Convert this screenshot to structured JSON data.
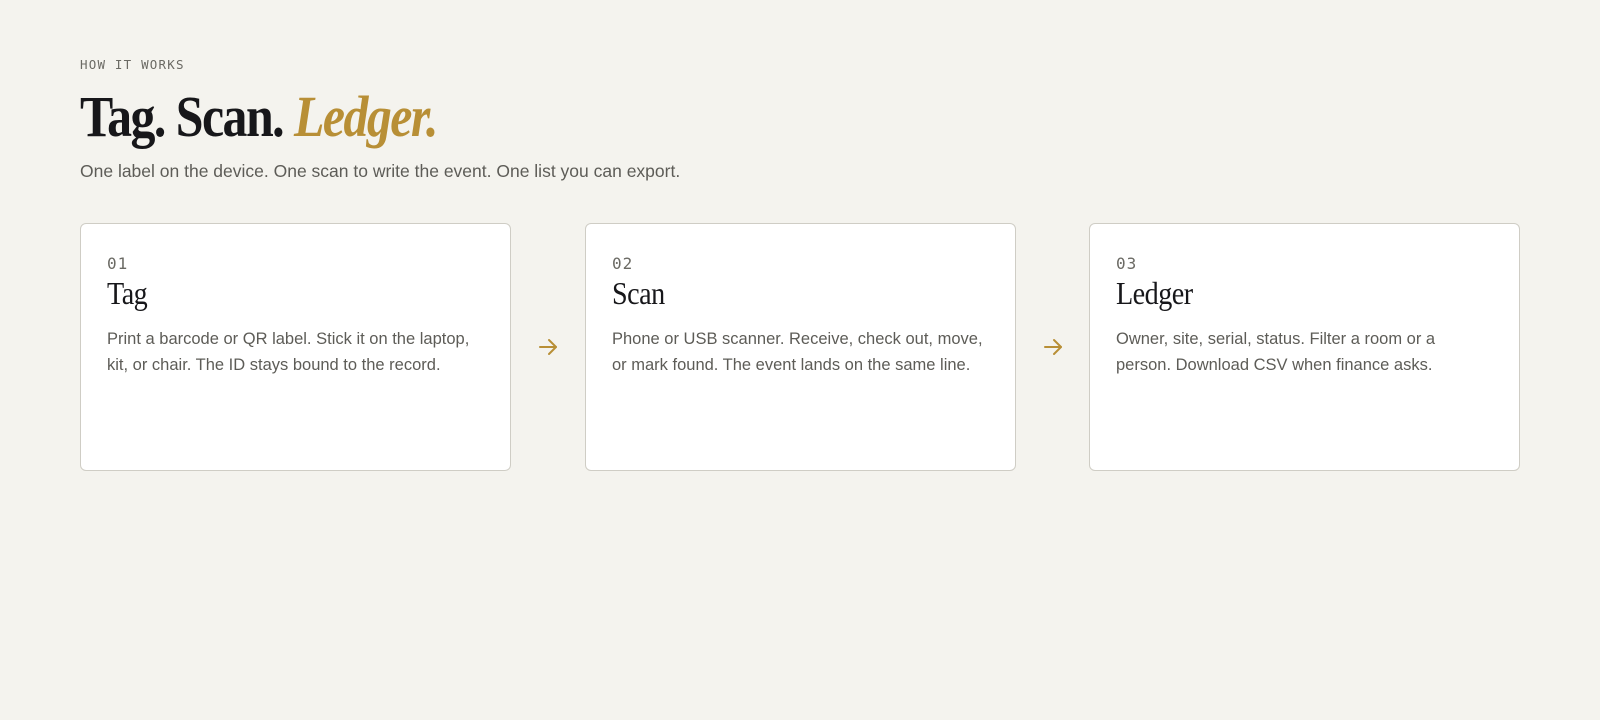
{
  "section": {
    "eyebrow": "HOW IT WORKS",
    "title_part1": "Tag. Scan.",
    "title_accent": "Ledger.",
    "subtitle": "One label on the device. One scan to write the event. One list you can export."
  },
  "steps": [
    {
      "number": "01",
      "title": "Tag",
      "body": "Print a barcode or QR label. Stick it on the laptop, kit, or chair. The ID stays bound to the record."
    },
    {
      "number": "02",
      "title": "Scan",
      "body": "Phone or USB scanner. Receive, check out, move, or mark found. The event lands on the same line."
    },
    {
      "number": "03",
      "title": "Ledger",
      "body": "Owner, site, serial, status. Filter a room or a person. Download CSV when finance asks."
    }
  ],
  "icons": {
    "connector": "arrow-right-icon"
  },
  "colors": {
    "background": "#f4f3ee",
    "accent": "#b88f36",
    "card_border": "#cfcdc5",
    "text_primary": "#17171a",
    "text_muted": "#5d5c57"
  }
}
